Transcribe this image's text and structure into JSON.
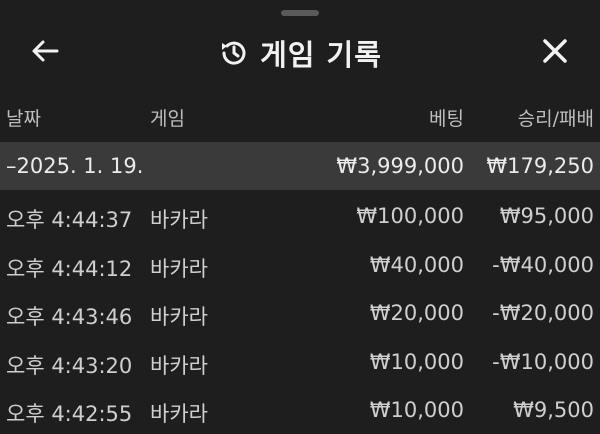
{
  "header": {
    "title": "게임 기록"
  },
  "columns": {
    "date": "날짜",
    "game": "게임",
    "bet": "베팅",
    "result": "승리/패배"
  },
  "date_group": {
    "label": "–2025. 1. 19.",
    "bet_total": "₩3,999,000",
    "result_total": "₩179,250"
  },
  "rows": [
    {
      "time": "오후 4:44:37",
      "game": "바카라",
      "bet": "₩100,000",
      "result": "₩95,000"
    },
    {
      "time": "오후 4:44:12",
      "game": "바카라",
      "bet": "₩40,000",
      "result": "-₩40,000"
    },
    {
      "time": "오후 4:43:46",
      "game": "바카라",
      "bet": "₩20,000",
      "result": "-₩20,000"
    },
    {
      "time": "오후 4:43:20",
      "game": "바카라",
      "bet": "₩10,000",
      "result": "-₩10,000"
    },
    {
      "time": "오후 4:42:55",
      "game": "바카라",
      "bet": "₩10,000",
      "result": "₩9,500"
    }
  ],
  "icons": {
    "back": "arrow-left-icon",
    "history": "history-icon",
    "close": "close-icon"
  },
  "colors": {
    "background": "#1e1e1e",
    "highlight_row": "#3a3a3a",
    "text": "#d9d9d9"
  }
}
